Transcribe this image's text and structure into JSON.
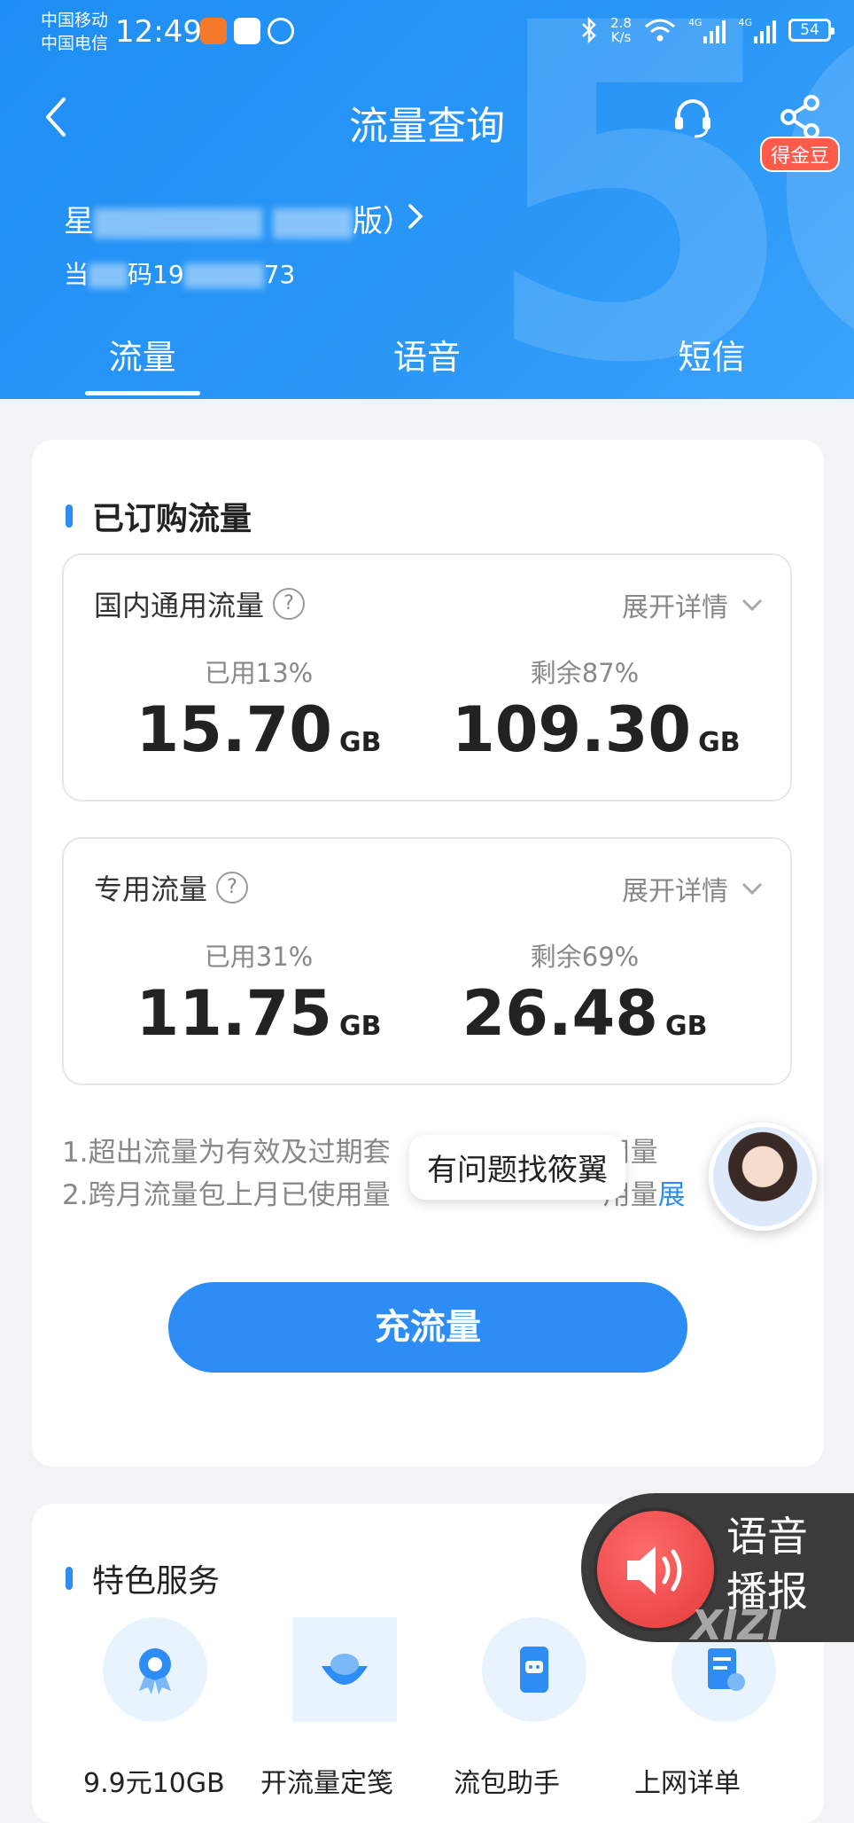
{
  "status_bar": {
    "carrier1": "中国移动",
    "carrier2": "中国电信",
    "time": "12:49",
    "speed_value": "2.8",
    "speed_unit": "K/s",
    "net1": "4G",
    "net2": "4G",
    "battery": "54"
  },
  "nav": {
    "title": "流量查询",
    "badge": "得金豆"
  },
  "account": {
    "plan_prefix": "星",
    "plan_suffix": "版）",
    "phone_prefix": "当",
    "phone_mid": "码19",
    "phone_tail": "73"
  },
  "tabs": [
    "流量",
    "语音",
    "短信"
  ],
  "subscribed": {
    "title": "已订购流量",
    "items": [
      {
        "name": "国内通用流量",
        "expand": "展开详情",
        "used_pct_label": "已用13%",
        "used": "15.70",
        "remain_pct_label": "剩余87%",
        "remain": "109.30",
        "unit": "GB"
      },
      {
        "name": "专用流量",
        "expand": "展开详情",
        "used_pct_label": "已用31%",
        "used": "11.75",
        "remain_pct_label": "剩余69%",
        "remain": "26.48",
        "unit": "GB"
      }
    ],
    "note1": "1.超出流量为有效及过期套",
    "note1_tail": "用量",
    "note2": "2.跨月流量包上月已使用量",
    "note2_tail": "用量",
    "note2_link": "展",
    "tooltip": "有问题找筱翼",
    "recharge": "充流量"
  },
  "features": {
    "title": "特色服务",
    "items": [
      "9.9元10GB",
      "开流量定笺",
      "流包助手",
      "上网详单"
    ]
  },
  "voice": {
    "line1": "语音",
    "line2": "播报"
  },
  "watermark": "XIZI",
  "colors": {
    "primary": "#2e8df4",
    "header": "#2a97f7",
    "badge": "#ff5b4a"
  }
}
